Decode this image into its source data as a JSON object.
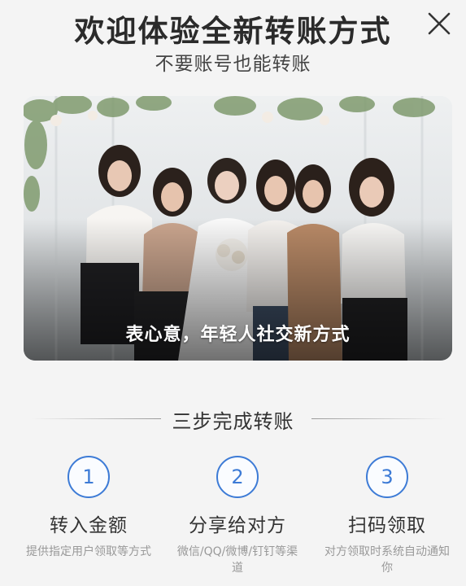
{
  "header": {
    "title": "欢迎体验全新转账方式",
    "subtitle": "不要账号也能转账"
  },
  "banner": {
    "caption": "表心意，年轻人社交新方式"
  },
  "steps_section": {
    "heading": "三步完成转账",
    "steps": [
      {
        "number": "1",
        "name": "转入金额",
        "desc": "提供指定用户领取等方式"
      },
      {
        "number": "2",
        "name": "分享给对方",
        "desc": "微信/QQ/微博/钉钉等渠道"
      },
      {
        "number": "3",
        "name": "扫码领取",
        "desc": "对方领取时系统自动通知你"
      }
    ]
  },
  "colors": {
    "accent": "#3d7bd6",
    "background": "#f4f4f4",
    "muted_text": "#999999"
  },
  "icons": {
    "close": "close-icon"
  }
}
